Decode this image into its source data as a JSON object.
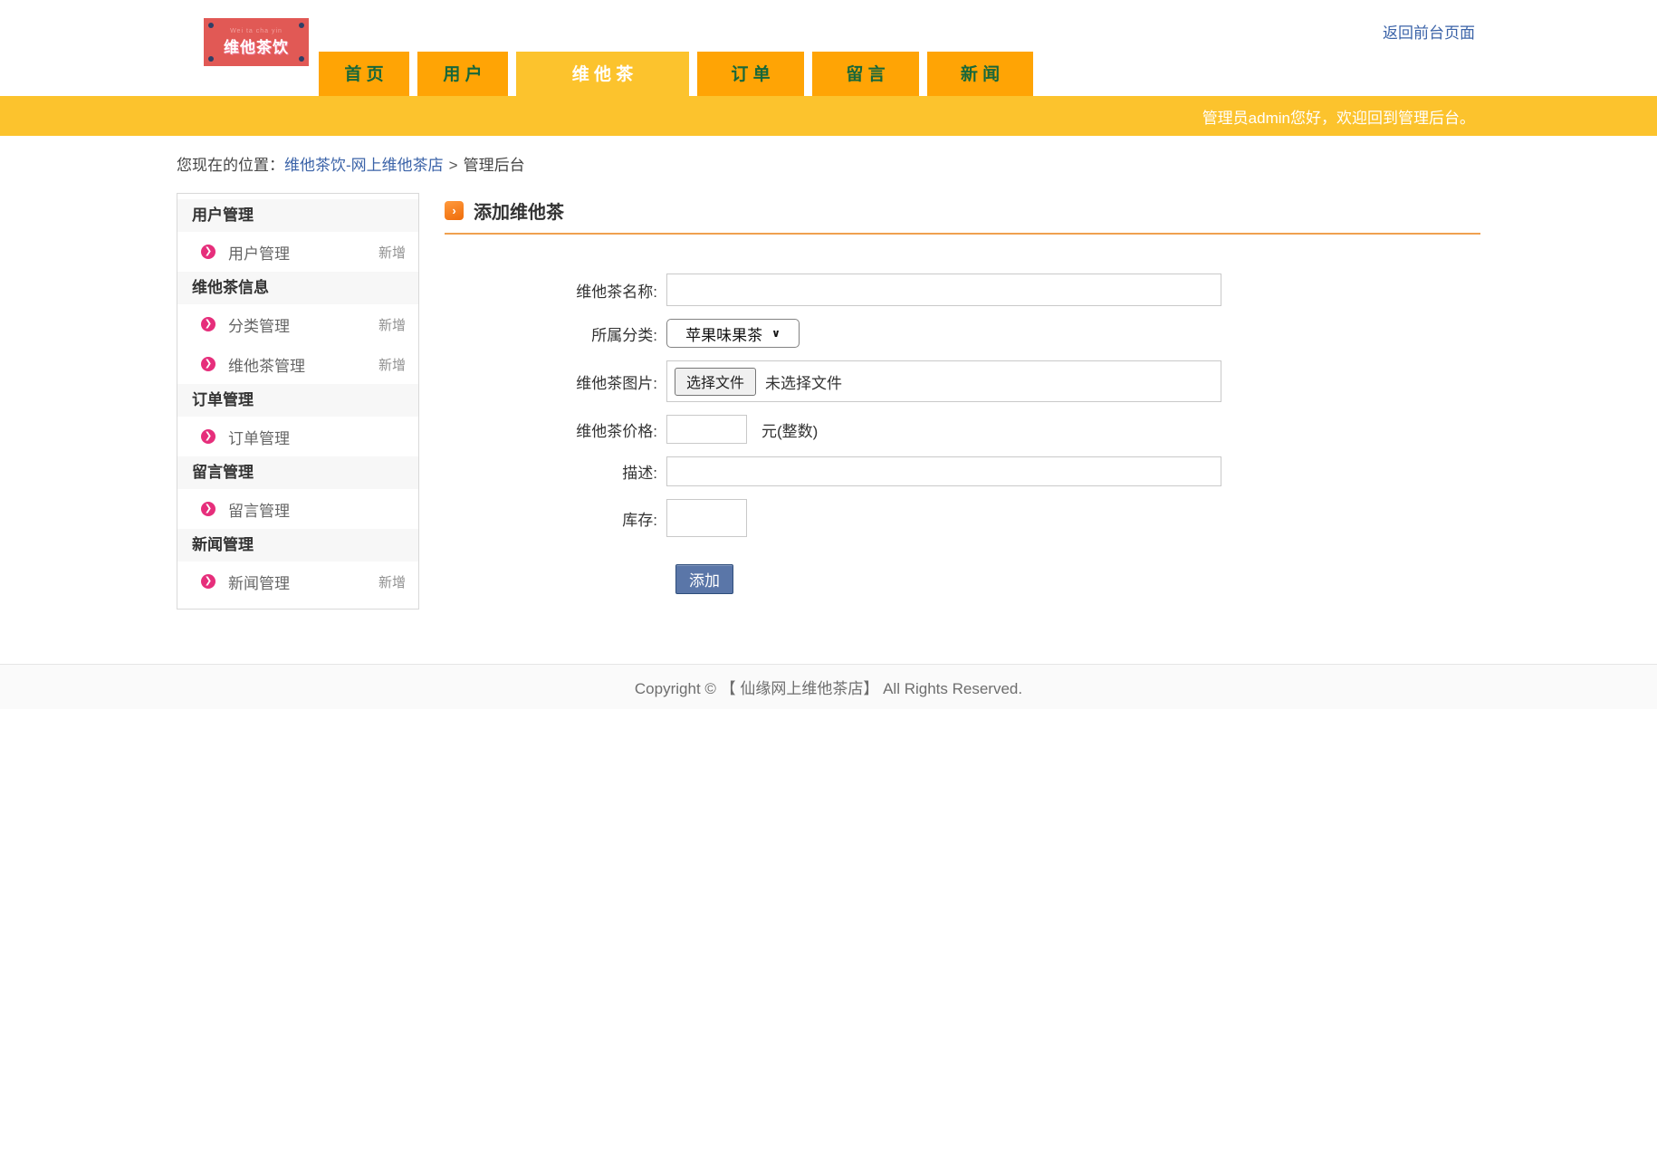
{
  "header": {
    "logo": {
      "pinyin": "Wei ta cha yin",
      "brand": "维他茶饮"
    },
    "back_link": "返回前台页面",
    "tabs": [
      {
        "label": "首 页",
        "active": false
      },
      {
        "label": "用 户",
        "active": false
      },
      {
        "label": "维 他 茶",
        "active": true
      },
      {
        "label": "订 单",
        "active": false
      },
      {
        "label": "留 言",
        "active": false
      },
      {
        "label": "新 闻",
        "active": false
      }
    ]
  },
  "banner": {
    "welcome": "管理员admin您好，欢迎回到管理后台。"
  },
  "breadcrumb": {
    "prefix": "您现在的位置：",
    "site_link": "维他茶饮-网上维他茶店",
    "separator": ">",
    "current": "管理后台"
  },
  "sidebar": {
    "sections": [
      {
        "header": "用户管理",
        "items": [
          {
            "label": "用户管理",
            "action": "新增"
          }
        ]
      },
      {
        "header": "维他茶信息",
        "items": [
          {
            "label": "分类管理",
            "action": "新增"
          },
          {
            "label": "维他茶管理",
            "action": "新增"
          }
        ]
      },
      {
        "header": "订单管理",
        "items": [
          {
            "label": "订单管理",
            "action": ""
          }
        ]
      },
      {
        "header": "留言管理",
        "items": [
          {
            "label": "留言管理",
            "action": ""
          }
        ]
      },
      {
        "header": "新闻管理",
        "items": [
          {
            "label": "新闻管理",
            "action": "新增"
          }
        ]
      }
    ]
  },
  "main": {
    "title": "添加维他茶",
    "title_icon": "›",
    "form": {
      "name_label": "维他茶名称:",
      "name_value": "",
      "category_label": "所属分类:",
      "category_value": "苹果味果茶",
      "category_chevron": "⌄",
      "image_label": "维他茶图片:",
      "file_button": "选择文件",
      "file_status": "未选择文件",
      "price_label": "维他茶价格:",
      "price_value": "",
      "price_unit": "元(整数)",
      "desc_label": "描述:",
      "desc_value": "",
      "stock_label": "库存:",
      "stock_value": "",
      "submit_label": "添加"
    }
  },
  "footer": {
    "copyright": "Copyright © 【 仙缘网上维他茶店】 All Rights Reserved."
  },
  "colors": {
    "tab_orange": "#ffa405",
    "active_yellow": "#fcc32d",
    "tab_text_green": "#17673a",
    "logo_red": "#e15955",
    "sidebar_icon_pink": "#e62e7b",
    "link_blue": "#3b63a8",
    "title_line_orange": "#f0a150",
    "submit_blue": "#5a76a8"
  }
}
